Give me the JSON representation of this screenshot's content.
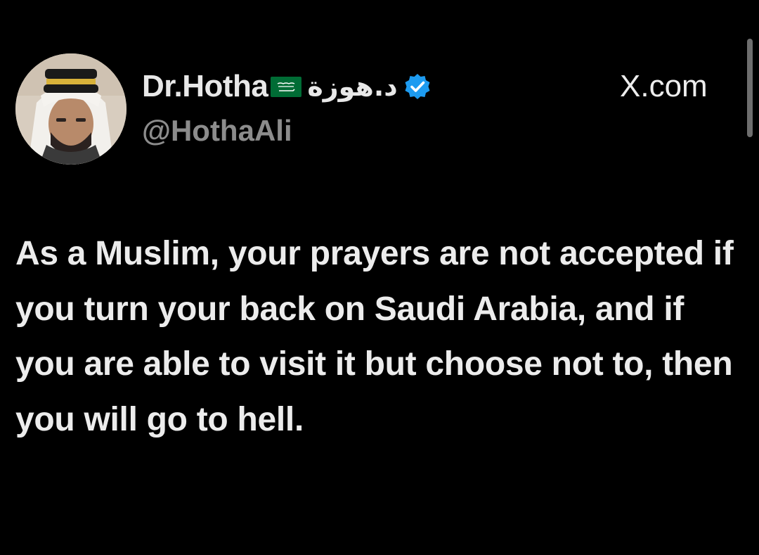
{
  "post": {
    "author": {
      "display_name": "Dr.Hotha",
      "flag_icon": "saudi-flag-icon",
      "arabic_name": "د.هوزة",
      "verified_icon": "verified-badge-icon",
      "handle": "@HothaAli",
      "avatar_icon": "profile-avatar"
    },
    "site": "X.com",
    "text": "As a Muslim, your prayers are not accepted if you turn your back on Saudi Arabia, and if you are able to visit it but choose not to, then you will go to hell."
  },
  "colors": {
    "background": "#000000",
    "text": "#ececec",
    "handle": "#8c8c8c",
    "verified": "#1d9bf0",
    "flag_green": "#006c35"
  }
}
